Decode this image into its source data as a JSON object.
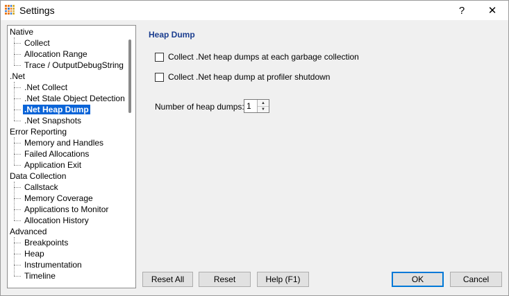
{
  "window": {
    "title": "Settings",
    "help_label": "?",
    "close_label": "✕"
  },
  "tree": [
    {
      "label": "Native",
      "level": 0
    },
    {
      "label": "Collect",
      "level": 1
    },
    {
      "label": "Allocation Range",
      "level": 1
    },
    {
      "label": "Trace / OutputDebugString",
      "level": 1
    },
    {
      "label": ".Net",
      "level": 0
    },
    {
      "label": ".Net Collect",
      "level": 1
    },
    {
      "label": ".Net Stale Object Detection",
      "level": 1
    },
    {
      "label": ".Net Heap Dump",
      "level": 1,
      "selected": true
    },
    {
      "label": ".Net Snapshots",
      "level": 1
    },
    {
      "label": "Error Reporting",
      "level": 0
    },
    {
      "label": "Memory and Handles",
      "level": 1
    },
    {
      "label": "Failed Allocations",
      "level": 1
    },
    {
      "label": "Application Exit",
      "level": 1
    },
    {
      "label": "Data Collection",
      "level": 0
    },
    {
      "label": "Callstack",
      "level": 1
    },
    {
      "label": "Memory Coverage",
      "level": 1
    },
    {
      "label": "Applications to Monitor",
      "level": 1
    },
    {
      "label": "Allocation History",
      "level": 1
    },
    {
      "label": "Advanced",
      "level": 0
    },
    {
      "label": "Breakpoints",
      "level": 1
    },
    {
      "label": "Heap",
      "level": 1
    },
    {
      "label": "Instrumentation",
      "level": 1
    },
    {
      "label": "Timeline",
      "level": 1
    }
  ],
  "panel": {
    "title": "Heap Dump",
    "checkbox_gc": {
      "label": "Collect .Net heap dumps at each garbage collection",
      "checked": false
    },
    "checkbox_shutdown": {
      "label": "Collect .Net heap dump at profiler shutdown",
      "checked": false
    },
    "heap_dumps_label": "Number of heap dumps:",
    "heap_dumps_value": "1"
  },
  "buttons": {
    "reset_all": "Reset All",
    "reset": "Reset",
    "help": "Help (F1)",
    "ok": "OK",
    "cancel": "Cancel"
  },
  "colors": {
    "selection": "#0a64d8",
    "panel_title": "#1a3d8f"
  }
}
